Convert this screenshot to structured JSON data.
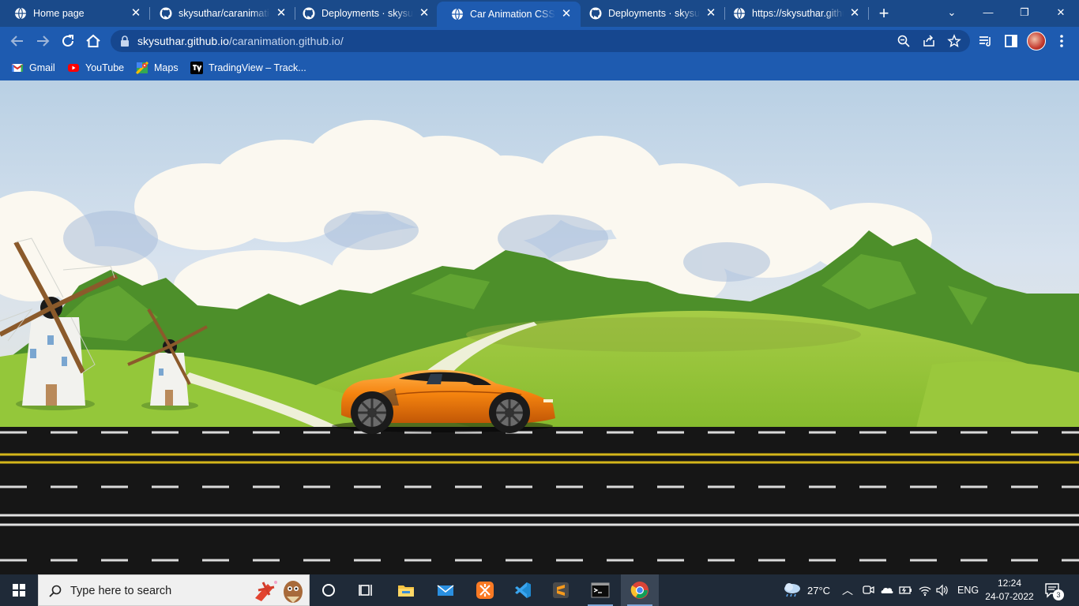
{
  "tabs": [
    {
      "title": "Home page",
      "favicon": "globe-icon"
    },
    {
      "title": "skysuthar/caranimation",
      "favicon": "github-icon"
    },
    {
      "title": "Deployments · skysuthar",
      "favicon": "github-icon"
    },
    {
      "title": "Car Animation CSS and",
      "favicon": "globe-icon",
      "active": true
    },
    {
      "title": "Deployments · skysuthar",
      "favicon": "github-icon"
    },
    {
      "title": "https://skysuthar.github.io",
      "favicon": "globe-icon"
    }
  ],
  "omnibox": {
    "host": "skysuthar.github.io",
    "path": "/caranimation.github.io/"
  },
  "bookmarks": [
    {
      "label": "Gmail",
      "icon": "gmail-icon"
    },
    {
      "label": "YouTube",
      "icon": "youtube-icon"
    },
    {
      "label": "Maps",
      "icon": "maps-icon"
    },
    {
      "label": "TradingView – Track...",
      "icon": "tradingview-icon"
    }
  ],
  "taskbar": {
    "search_placeholder": "Type here to search",
    "apps": [
      "file-explorer-icon",
      "mail-icon",
      "xampp-icon",
      "vscode-icon",
      "sublime-text-icon",
      "terminal-icon",
      "chrome-icon"
    ],
    "weather_temp": "27°C",
    "language": "ENG",
    "time": "12:24",
    "date": "24-07-2022",
    "notification_count": "3"
  },
  "colors": {
    "tabstrip": "#1a4a8a",
    "toolbar": "#1e5bb0",
    "car": "#f07d10",
    "grass": "#8fc33a",
    "road": "#161616"
  }
}
